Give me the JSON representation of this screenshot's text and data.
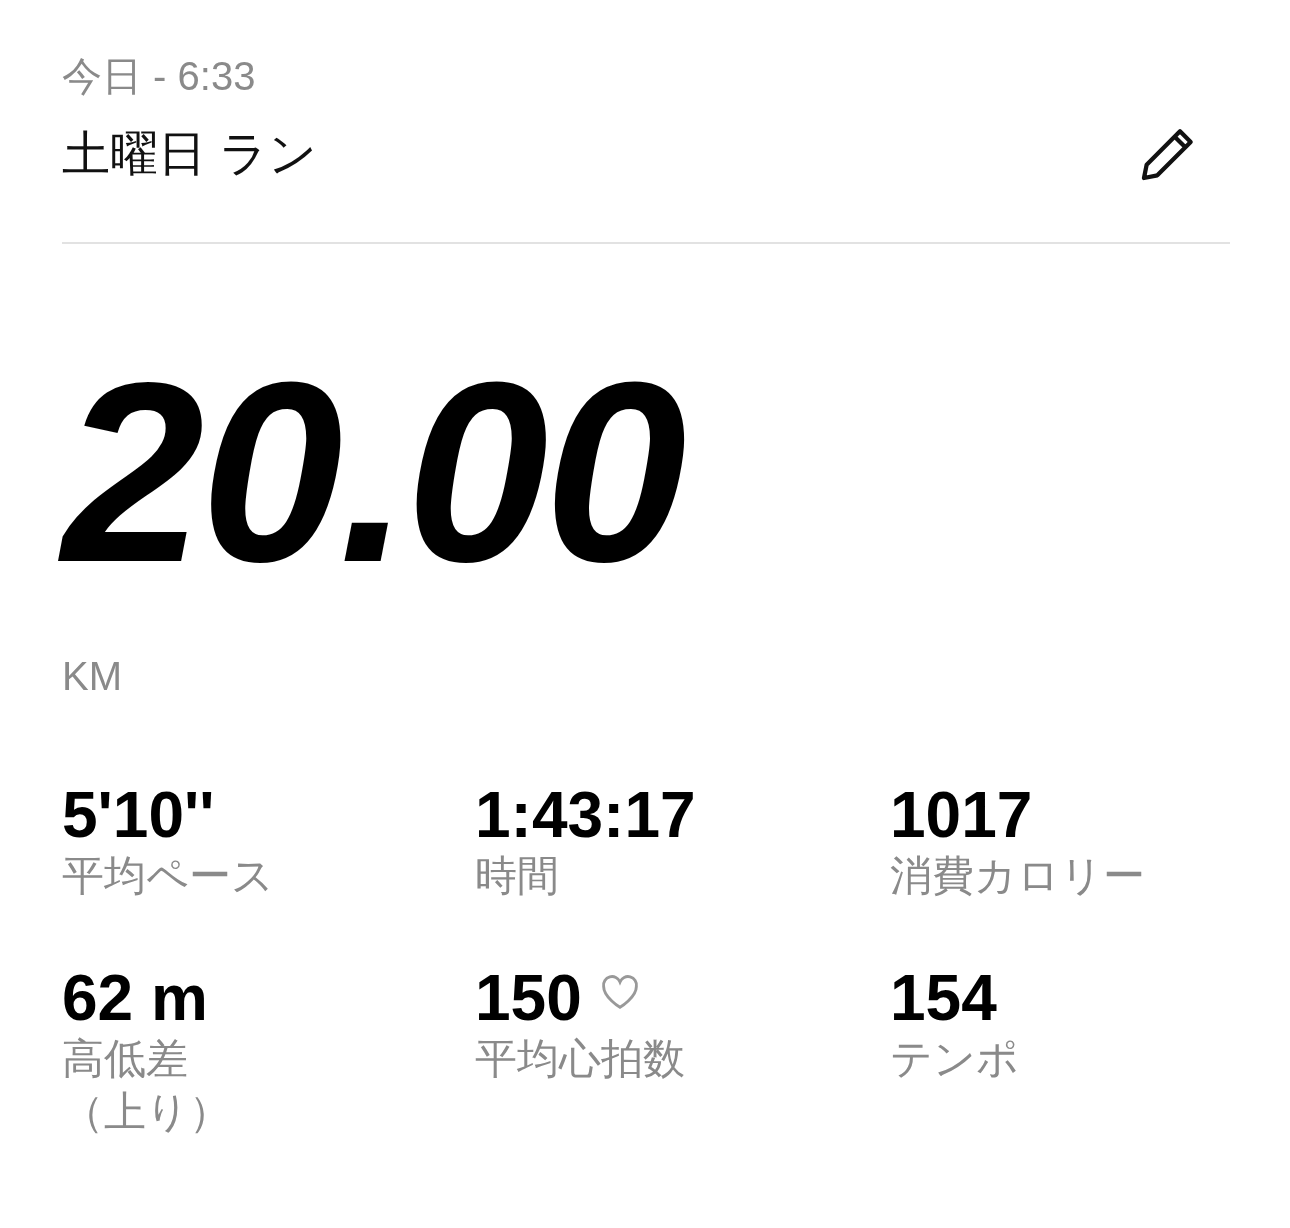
{
  "header": {
    "date": "今日 - 6:33",
    "title": "土曜日 ラン"
  },
  "distance": {
    "value": "20.00",
    "unit": "KM"
  },
  "stats": [
    {
      "value": "5'10''",
      "label": "平均ペース",
      "kind": "plain"
    },
    {
      "value": "1:43:17",
      "label": "時間",
      "kind": "plain"
    },
    {
      "value": "1017",
      "label": "消費カロリー",
      "kind": "plain"
    },
    {
      "value": "62 m",
      "label": "高低差（上り）",
      "kind": "plain"
    },
    {
      "value": "150",
      "label": "平均心拍数",
      "kind": "heart_rate"
    },
    {
      "value": "154",
      "label": "テンポ",
      "kind": "plain"
    }
  ]
}
